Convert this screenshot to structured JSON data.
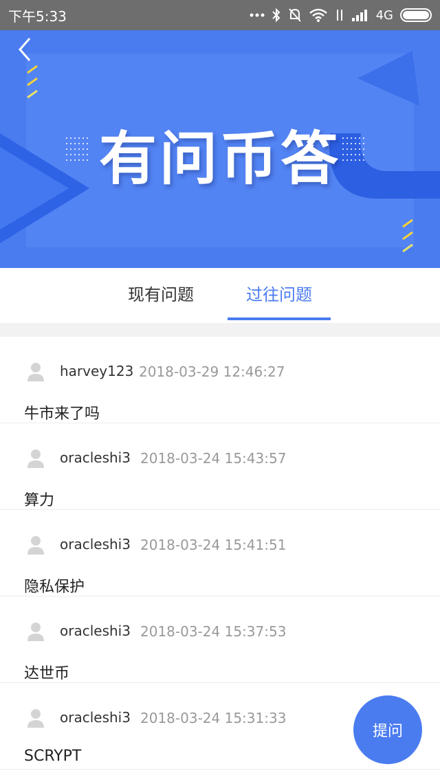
{
  "status_bar": {
    "time": "下午5:33",
    "network": "4G"
  },
  "banner": {
    "title": "有问币答"
  },
  "tabs": [
    {
      "label": "现有问题",
      "active": false
    },
    {
      "label": "过往问题",
      "active": true
    }
  ],
  "questions": [
    {
      "user": "harvey123",
      "time": "2018-03-29 12:46:27",
      "text": "牛市来了吗"
    },
    {
      "user": "oracleshi3",
      "time": "2018-03-24 15:43:57",
      "text": "算力"
    },
    {
      "user": "oracleshi3",
      "time": "2018-03-24 15:41:51",
      "text": "隐私保护"
    },
    {
      "user": "oracleshi3",
      "time": "2018-03-24 15:37:53",
      "text": "达世币"
    },
    {
      "user": "oracleshi3",
      "time": "2018-03-24 15:31:33",
      "text": "SCRYPT"
    }
  ],
  "ask_button": {
    "label": "提问"
  },
  "colors": {
    "accent": "#4a7cf0",
    "status_bar": "#6e6e6e"
  }
}
